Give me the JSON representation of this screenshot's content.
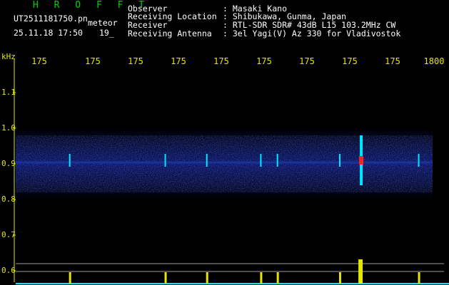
{
  "header": {
    "station": "H R O F F T",
    "filename": "UT2511181750.pn",
    "type_label": "meteor",
    "datetime": "25.11.18 17:50",
    "count": "19_",
    "info": [
      {
        "label": "Observer",
        "value": ": Masaki Kano"
      },
      {
        "label": "Receiving Location",
        "value": ": Shibukawa, Gunma, Japan"
      },
      {
        "label": "Receiver",
        "value": ": RTL-SDR SDR# 43dB L15 103.2MHz CW"
      },
      {
        "label": "Receiving Antenna",
        "value": ": 3el Yagi(V) Az 330 for Vladivostok"
      }
    ]
  },
  "axes": {
    "y_unit": "kHz",
    "x_ticks": [
      "175",
      "175",
      "175",
      "175",
      "175",
      "175",
      "175",
      "175",
      "175",
      "1800"
    ],
    "y_ticks": [
      "1.1",
      "1.0",
      "0.9",
      "0.8",
      "0.7",
      "0.6"
    ]
  },
  "colors": {
    "title": "#00d200",
    "tick": "#e6e600",
    "band": "#0a1050",
    "signal": "#00e6ff",
    "meteor_hot": "#ff2020",
    "level": "#00e6ff"
  },
  "chart_data": {
    "type": "heatmap",
    "x_label_last": "1800",
    "y_range_khz": [
      0.58,
      1.17
    ],
    "noise_band_khz": [
      0.82,
      0.98
    ],
    "signal_center_khz": 0.91,
    "meteor_echo_minutes": [
      1751.3,
      1753.6,
      1754.6,
      1755.9,
      1756.3,
      1757.8,
      1758.3,
      1759.7
    ],
    "strong_echo_minute": 1758.3
  }
}
